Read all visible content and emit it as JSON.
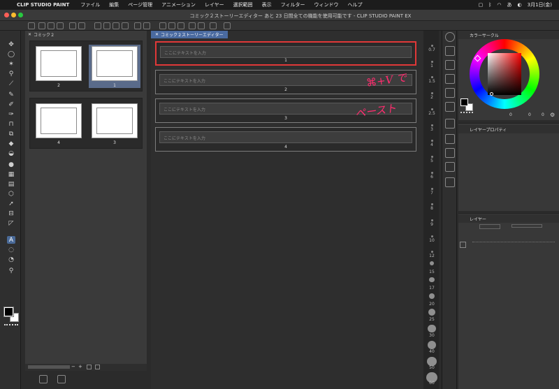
{
  "menubar": {
    "apple": "",
    "app_name": "CLIP STUDIO PAINT",
    "items": [
      "ファイル",
      "編集",
      "ページ管理",
      "アニメーション",
      "レイヤー",
      "選択範囲",
      "表示",
      "フィルター",
      "ウィンドウ",
      "ヘルプ"
    ],
    "input_indicator": "あ",
    "date": "3月1日(金)"
  },
  "window": {
    "title": "コミック２ストーリーエディター あと 23 日間全ての機能を使用可能です - CLIP STUDIO PAINT EX"
  },
  "page_panel": {
    "tab": "コミック２",
    "rows": [
      [
        {
          "num": "2",
          "selected": false
        },
        {
          "num": "1",
          "selected": true
        }
      ],
      [
        {
          "num": "4",
          "selected": false
        },
        {
          "num": "3",
          "selected": false
        }
      ]
    ]
  },
  "story_editor": {
    "tab": "コミック２ストーリーエディター",
    "placeholder": "ここにテキストを入力",
    "cards": [
      {
        "num": "1",
        "highlighted": true
      },
      {
        "num": "2",
        "highlighted": false
      },
      {
        "num": "3",
        "highlighted": false
      },
      {
        "num": "4",
        "highlighted": false
      }
    ]
  },
  "annotations": {
    "shortcut": "⌘+V で",
    "paste": "ペースト"
  },
  "ruler": {
    "labels": [
      "0.7",
      "1",
      "1.5",
      "2",
      "2.5",
      "3",
      "4",
      "5",
      "6",
      "7",
      "8",
      "9",
      "10",
      "12",
      "15",
      "17",
      "20",
      "25",
      "30",
      "40",
      "50",
      "60"
    ]
  },
  "color_panel": {
    "title": "カラーサークル",
    "values": [
      "0",
      "0",
      "0"
    ],
    "selected_color": "#c0151b"
  },
  "layer_property_panel": {
    "title": "レイヤープロパティ"
  },
  "layer_panel": {
    "title": "レイヤー"
  },
  "colors": {
    "accent": "#4a6aa0",
    "highlight": "#e03838",
    "annotation": "#ff2d6f"
  }
}
